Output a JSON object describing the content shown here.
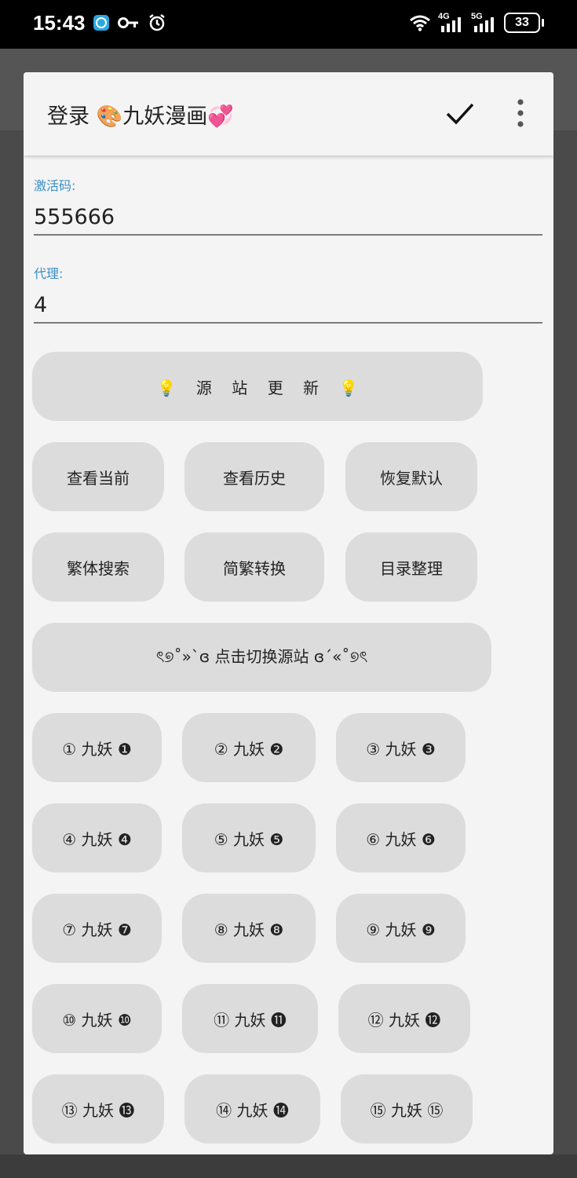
{
  "status_bar": {
    "time": "15:43",
    "net1": "4G",
    "net2": "5G",
    "battery": "33"
  },
  "dialog": {
    "title": "登录 🎨九妖漫画💞"
  },
  "fields": {
    "activation_code": {
      "label": "激活码:",
      "value": "555666"
    },
    "proxy": {
      "label": "代理:",
      "value": "4"
    }
  },
  "buttons": {
    "source_update": "💡    源    站    更    新    💡",
    "view_current": "查看当前",
    "view_history": "查看历史",
    "restore_default": "恢复默认",
    "trad_search": "繁体搜索",
    "simp_trad_convert": "简繁转换",
    "catalog_organize": "目录整理",
    "switch_source": "ৎ୭˚»`ɞ 点击切换源站 ɞ´«˚୭ৎ",
    "sources": [
      "① 九妖 ❶",
      "② 九妖 ❷",
      "③ 九妖 ❸",
      "④ 九妖 ❹",
      "⑤ 九妖 ❺",
      "⑥ 九妖 ❻",
      "⑦ 九妖 ❼",
      "⑧ 九妖 ❽",
      "⑨ 九妖 ❾",
      "⑩ 九妖 ❿",
      "⑪ 九妖 ⓫",
      "⑫ 九妖 ⓬",
      "⑬ 九妖 ⓭",
      "⑭ 九妖 ⓮",
      "⑮ 九妖 ⑮"
    ]
  }
}
